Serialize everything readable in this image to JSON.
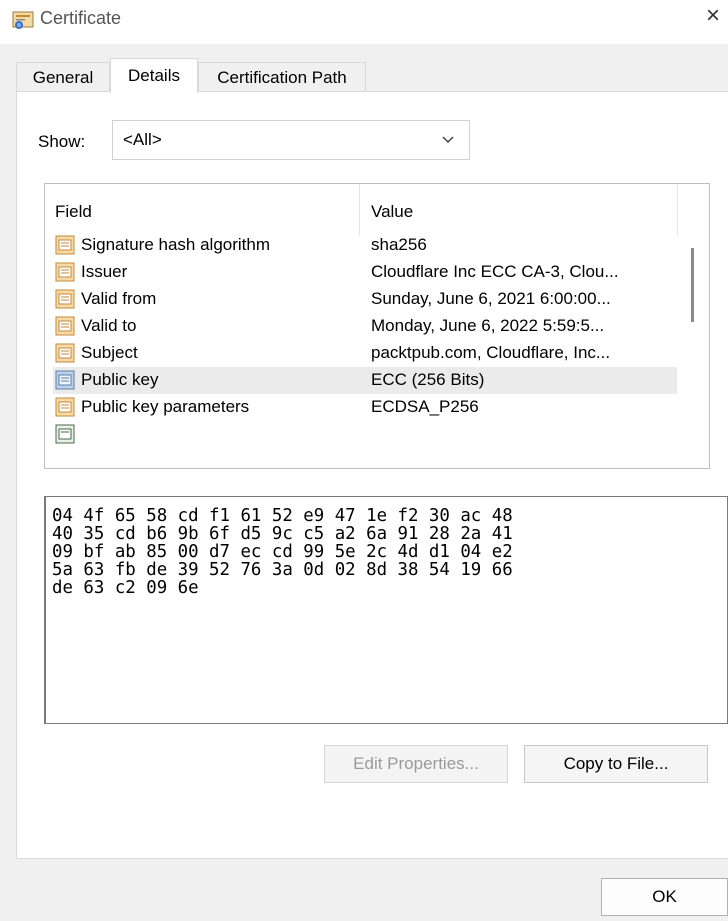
{
  "window": {
    "title": "Certificate",
    "close_glyph": "×"
  },
  "tabs": [
    {
      "label": "General"
    },
    {
      "label": "Details"
    },
    {
      "label": "Certification Path"
    }
  ],
  "show": {
    "label": "Show:",
    "value": "<All>"
  },
  "list": {
    "headers": {
      "field": "Field",
      "value": "Value"
    },
    "rows": [
      {
        "field": "Signature hash algorithm",
        "value": "sha256"
      },
      {
        "field": "Issuer",
        "value": "Cloudflare Inc ECC CA-3, Clou..."
      },
      {
        "field": "Valid from",
        "value": "Sunday, June 6, 2021 6:00:00..."
      },
      {
        "field": "Valid to",
        "value": "Monday, June 6, 2022 5:59:5..."
      },
      {
        "field": "Subject",
        "value": "packtpub.com, Cloudflare, Inc..."
      },
      {
        "field": "Public key",
        "value": "ECC (256 Bits)"
      },
      {
        "field": "Public key parameters",
        "value": "ECDSA_P256"
      },
      {
        "field": "",
        "value": ""
      }
    ]
  },
  "hex_lines": [
    "04 4f 65 58 cd f1 61 52 e9 47 1e f2 30 ac 48",
    "40 35 cd b6 9b 6f d5 9c c5 a2 6a 91 28 2a 41",
    "09 bf ab 85 00 d7 ec cd 99 5e 2c 4d d1 04 e2",
    "5a 63 fb de 39 52 76 3a 0d 02 8d 38 54 19 66",
    "de 63 c2 09 6e"
  ],
  "buttons": {
    "edit_properties": "Edit Properties...",
    "copy_to_file": "Copy to File...",
    "ok": "OK"
  },
  "colors": {
    "selected_row": "#ebebeb",
    "window_bg": "#f0f0f0",
    "panel_bg": "#ffffff"
  },
  "icons": {
    "certificate": "certificate-icon",
    "field": "field-icon",
    "public_key": "public-key-icon",
    "close": "close-icon",
    "dropdown": "chevron-down-icon"
  }
}
